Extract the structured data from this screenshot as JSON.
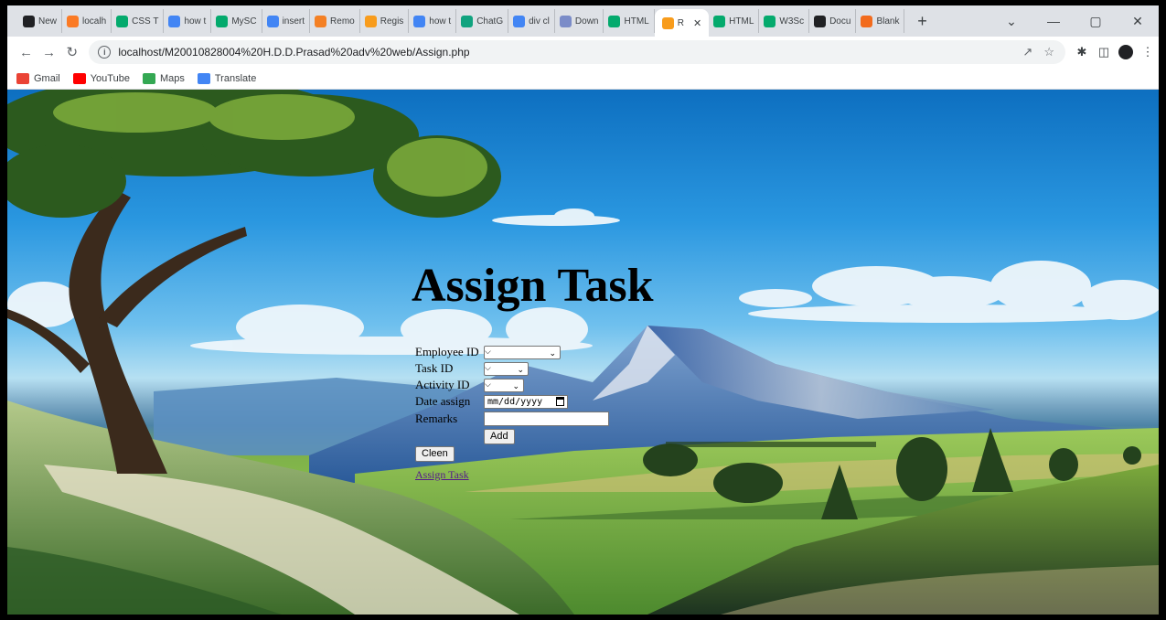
{
  "browser": {
    "tabs": [
      {
        "label": "New",
        "icon": "chatgpt-icon",
        "color": "#202124"
      },
      {
        "label": "localh",
        "icon": "xampp-icon",
        "color": "#fb7a24"
      },
      {
        "label": "CSS T",
        "icon": "w3schools-icon",
        "color": "#04aa6d"
      },
      {
        "label": "how t",
        "icon": "google-icon",
        "color": "#4285f4"
      },
      {
        "label": "MySC",
        "icon": "w3schools-icon",
        "color": "#04aa6d"
      },
      {
        "label": "insert",
        "icon": "google-icon",
        "color": "#4285f4"
      },
      {
        "label": "Remo",
        "icon": "stackoverflow-icon",
        "color": "#f48024"
      },
      {
        "label": "Regis",
        "icon": "codepen-icon",
        "color": "#f89c1c"
      },
      {
        "label": "how t",
        "icon": "google-icon",
        "color": "#4285f4"
      },
      {
        "label": "ChatG",
        "icon": "chatgpt-icon",
        "color": "#10a37f"
      },
      {
        "label": "div cl",
        "icon": "google-icon",
        "color": "#4285f4"
      },
      {
        "label": "Down",
        "icon": "download-icon",
        "color": "#7b8cc8"
      },
      {
        "label": "HTML",
        "icon": "w3schools-icon",
        "color": "#04aa6d"
      },
      {
        "label": "R",
        "icon": "codepen-icon",
        "color": "#f89c1c",
        "active": true
      },
      {
        "label": "HTML",
        "icon": "w3schools-icon",
        "color": "#04aa6d"
      },
      {
        "label": "W3Sc",
        "icon": "w3schools-icon",
        "color": "#04aa6d"
      },
      {
        "label": "Docu",
        "icon": "docs-icon",
        "color": "#202124"
      },
      {
        "label": "Blank",
        "icon": "blank-icon",
        "color": "#f26b1d"
      }
    ],
    "url": "localhost/M20010828004%20H.D.D.Prasad%20adv%20web/Assign.php",
    "bookmarks": [
      {
        "label": "Gmail",
        "icon": "gmail-icon",
        "color": "#ea4335"
      },
      {
        "label": "YouTube",
        "icon": "youtube-icon",
        "color": "#ff0000"
      },
      {
        "label": "Maps",
        "icon": "maps-icon",
        "color": "#34a853"
      },
      {
        "label": "Translate",
        "icon": "translate-icon",
        "color": "#4285f4"
      }
    ]
  },
  "page": {
    "title": "Assign Task",
    "fields": {
      "employee_id": "Employee ID",
      "task_id": "Task ID",
      "activity_id": "Activity ID",
      "date_assign": "Date assign",
      "remarks": "Remarks"
    },
    "date_placeholder": "mm/dd/yyyy",
    "add_label": "Add",
    "clean_label": "Cleen",
    "link_label": "Assign Task"
  }
}
